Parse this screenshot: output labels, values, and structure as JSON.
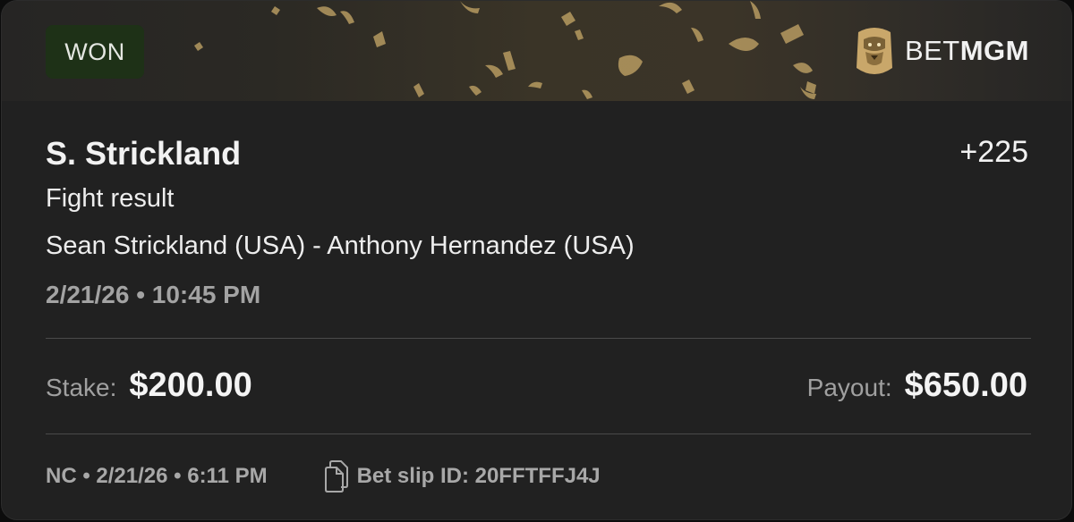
{
  "header": {
    "status_label": "WON",
    "brand": {
      "bet": "BET",
      "mgm": "MGM"
    }
  },
  "bet": {
    "selection": "S. Strickland",
    "odds": "+225",
    "market": "Fight result",
    "event": "Sean Strickland (USA) - Anthony Hernandez (USA)",
    "event_time": "2/21/26 • 10:45 PM"
  },
  "amounts": {
    "stake_label": "Stake:",
    "stake_value": "$200.00",
    "payout_label": "Payout:",
    "payout_value": "$650.00"
  },
  "footer": {
    "placed": "NC • 2/21/26 • 6:11 PM",
    "bet_slip": "Bet slip ID: 20FFTFFJ4J"
  },
  "icons": {
    "brand_logo": "lion-head-logo",
    "bet_slip": "document-copy-icon"
  },
  "colors": {
    "card_background": "#212121",
    "won_badge_background": "#1e3117",
    "confetti_gold": "#c9aa6a"
  }
}
